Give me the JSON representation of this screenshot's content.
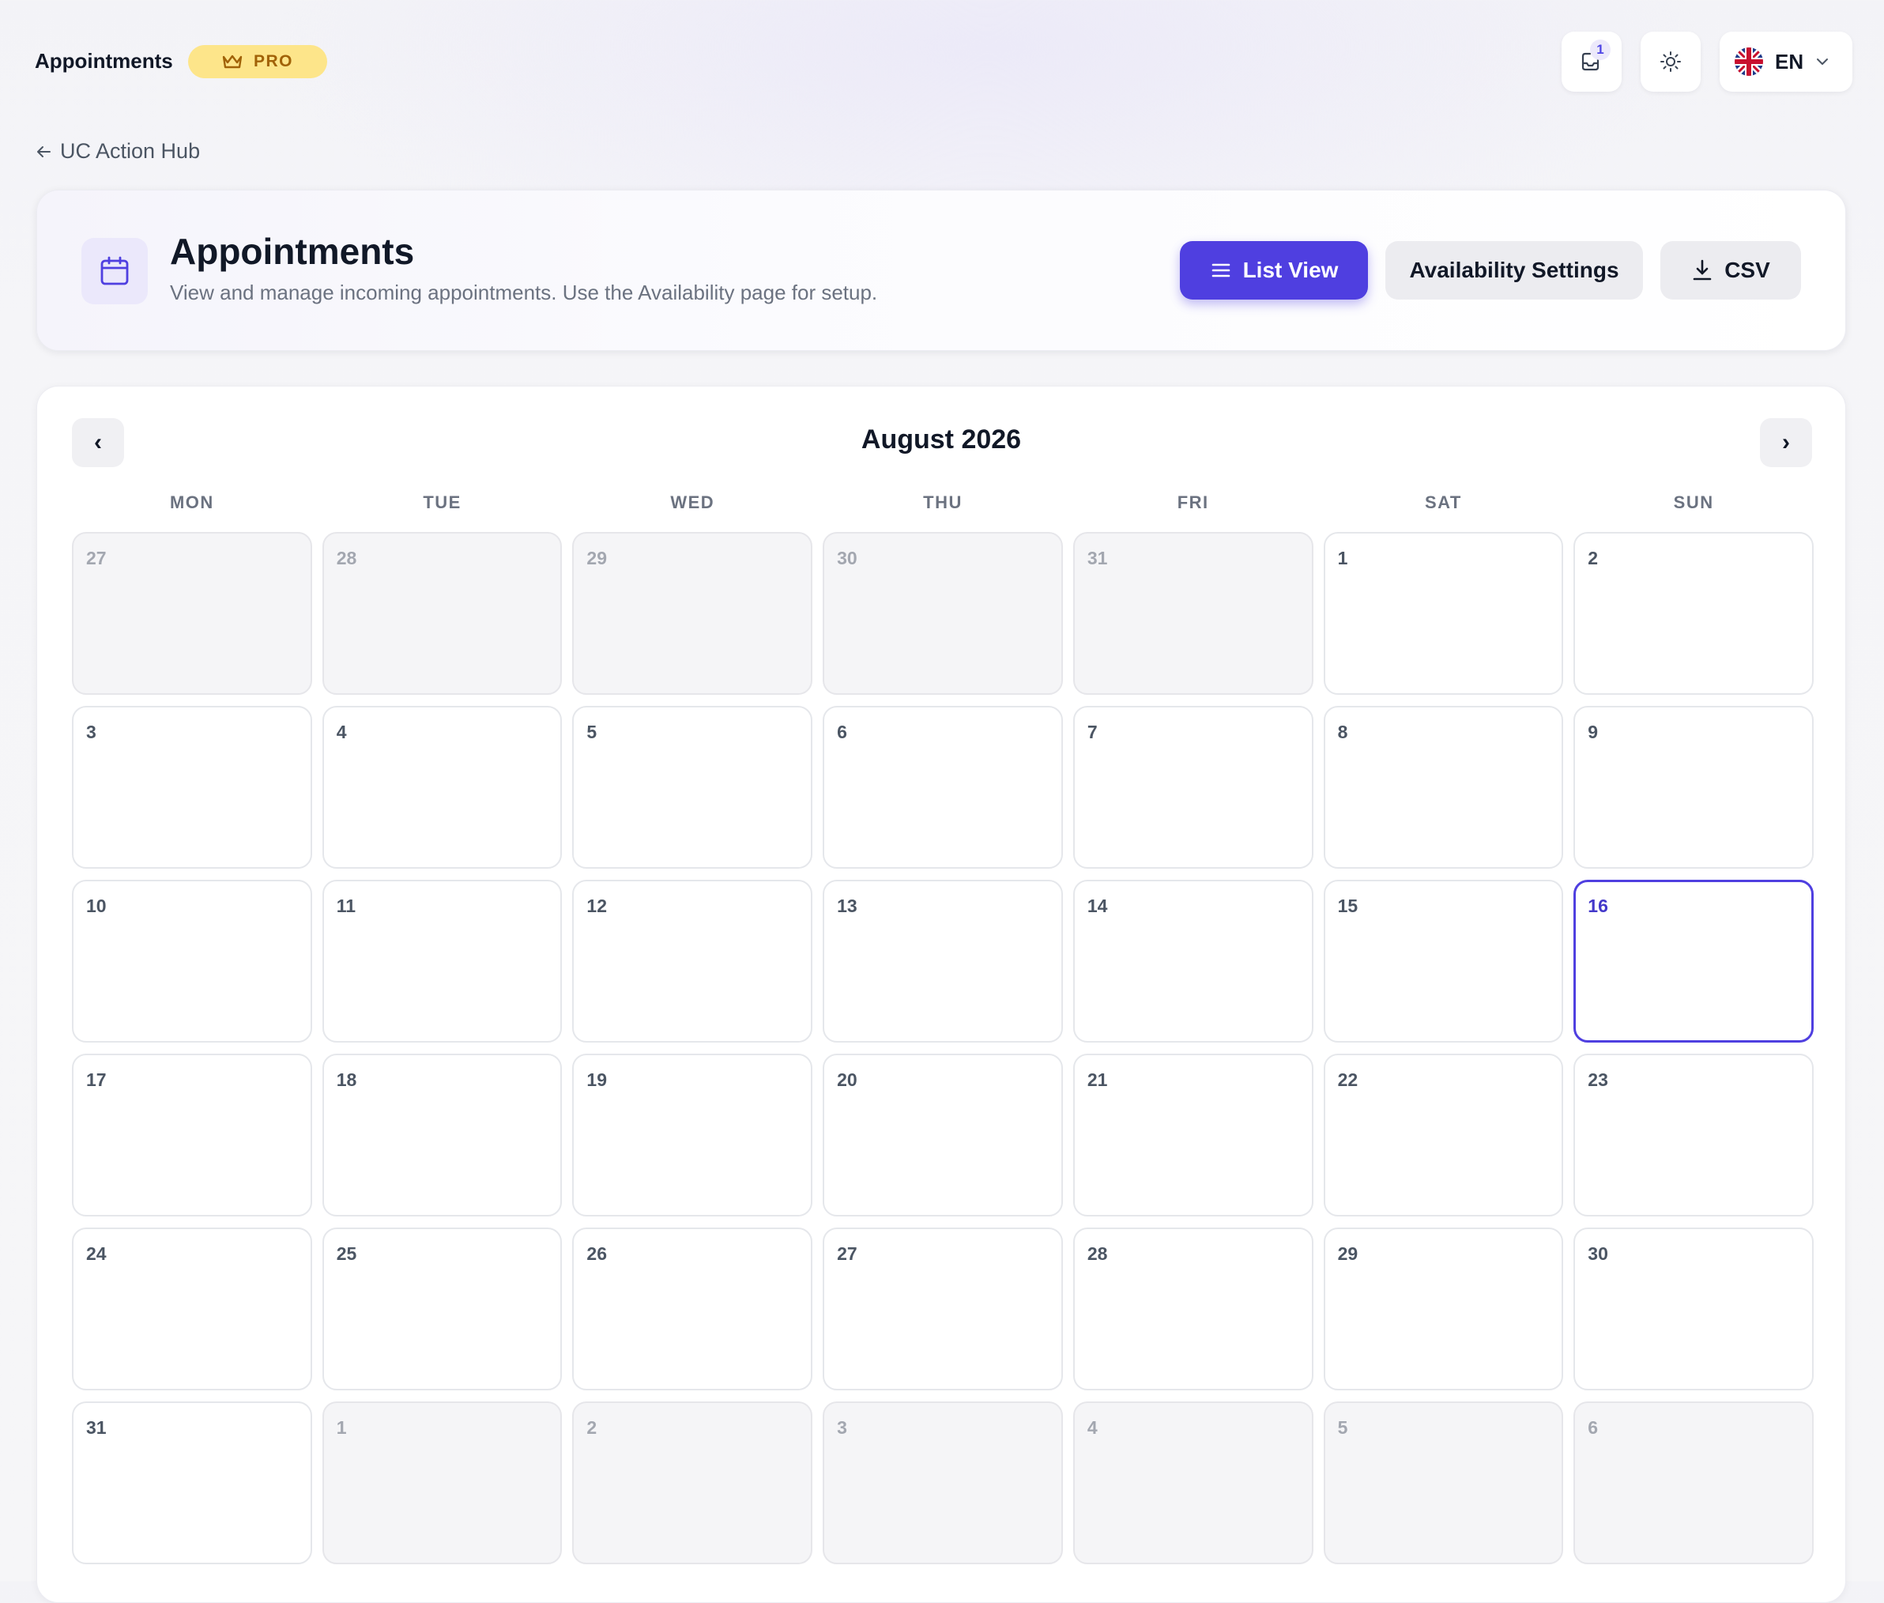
{
  "topbar": {
    "app_title": "Appointments",
    "pro_badge": "PRO",
    "notifications_count": "1",
    "language": "EN"
  },
  "back_link": "UC Action Hub",
  "header": {
    "title": "Appointments",
    "subtitle": "View and manage incoming appointments. Use the Availability page for setup.",
    "list_view_label": "List View",
    "availability_label": "Availability Settings",
    "csv_label": "CSV"
  },
  "calendar": {
    "month_title": "August 2026",
    "prev_label": "‹",
    "next_label": "›",
    "weekdays": [
      "MON",
      "TUE",
      "WED",
      "THU",
      "FRI",
      "SAT",
      "SUN"
    ],
    "days": [
      {
        "n": "27",
        "outside": true
      },
      {
        "n": "28",
        "outside": true
      },
      {
        "n": "29",
        "outside": true
      },
      {
        "n": "30",
        "outside": true
      },
      {
        "n": "31",
        "outside": true
      },
      {
        "n": "1"
      },
      {
        "n": "2"
      },
      {
        "n": "3"
      },
      {
        "n": "4"
      },
      {
        "n": "5"
      },
      {
        "n": "6"
      },
      {
        "n": "7"
      },
      {
        "n": "8"
      },
      {
        "n": "9"
      },
      {
        "n": "10"
      },
      {
        "n": "11"
      },
      {
        "n": "12"
      },
      {
        "n": "13"
      },
      {
        "n": "14"
      },
      {
        "n": "15"
      },
      {
        "n": "16",
        "today": true
      },
      {
        "n": "17"
      },
      {
        "n": "18"
      },
      {
        "n": "19"
      },
      {
        "n": "20"
      },
      {
        "n": "21"
      },
      {
        "n": "22"
      },
      {
        "n": "23"
      },
      {
        "n": "24"
      },
      {
        "n": "25"
      },
      {
        "n": "26"
      },
      {
        "n": "27"
      },
      {
        "n": "28"
      },
      {
        "n": "29"
      },
      {
        "n": "30"
      },
      {
        "n": "31"
      },
      {
        "n": "1",
        "outside": true
      },
      {
        "n": "2",
        "outside": true
      },
      {
        "n": "3",
        "outside": true
      },
      {
        "n": "4",
        "outside": true
      },
      {
        "n": "5",
        "outside": true
      },
      {
        "n": "6",
        "outside": true
      }
    ]
  },
  "colors": {
    "accent": "#4f3fe0",
    "pro_badge_bg": "#fde58a",
    "pro_badge_text": "#a16207"
  },
  "icons": {
    "pro": "crown-icon",
    "notifications": "inbox-icon",
    "theme": "sun-icon",
    "language_flag": "uk-flag-icon",
    "language_menu": "chevron-down-icon",
    "back": "arrow-left-icon",
    "header": "calendar-icon",
    "list_view": "list-icon",
    "csv": "download-icon"
  }
}
